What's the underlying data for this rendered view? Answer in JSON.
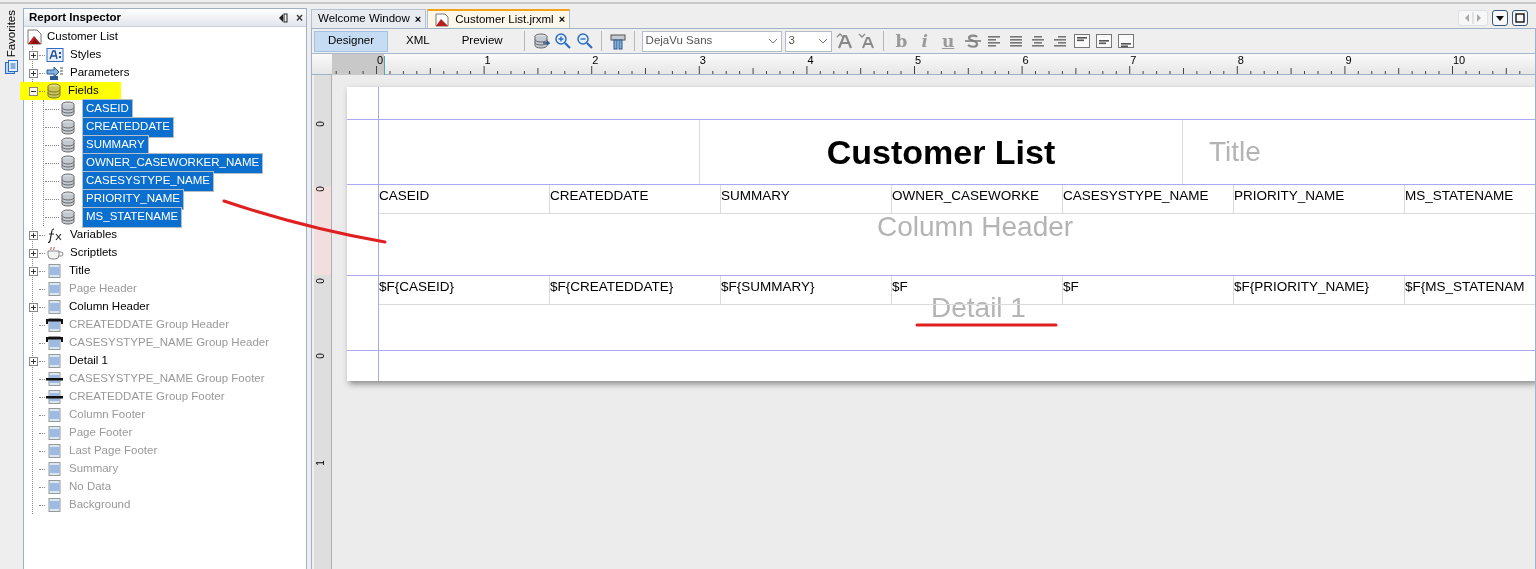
{
  "favorites_strip": {
    "label": "Favorites"
  },
  "inspector": {
    "title": "Report Inspector",
    "close": "×",
    "root": {
      "label": "Customer List"
    },
    "items": [
      {
        "label": "Styles",
        "kind": "styles",
        "expanded": false,
        "disabled": false,
        "highlighted": false
      },
      {
        "label": "Parameters",
        "kind": "parameters",
        "expanded": false,
        "disabled": false,
        "highlighted": false
      },
      {
        "label": "Fields",
        "kind": "fields",
        "expanded": true,
        "disabled": false,
        "highlighted": true,
        "children": [
          {
            "label": "CASEID",
            "selected": true
          },
          {
            "label": "CREATEDDATE",
            "selected": true
          },
          {
            "label": "SUMMARY",
            "selected": true
          },
          {
            "label": "OWNER_CASEWORKER_NAME",
            "selected": true
          },
          {
            "label": "CASESYSTYPE_NAME",
            "selected": true
          },
          {
            "label": "PRIORITY_NAME",
            "selected": true
          },
          {
            "label": "MS_STATENAME",
            "selected": true
          }
        ]
      },
      {
        "label": "Variables",
        "kind": "variables",
        "expanded": false,
        "disabled": false,
        "highlighted": false
      },
      {
        "label": "Scriptlets",
        "kind": "scriptlets",
        "expanded": false,
        "disabled": false,
        "highlighted": false
      },
      {
        "label": "Title",
        "kind": "band",
        "expanded": false,
        "disabled": false,
        "highlighted": false
      },
      {
        "label": "Page Header",
        "kind": "band",
        "disabled": true,
        "highlighted": false
      },
      {
        "label": "Column Header",
        "kind": "band",
        "expanded": false,
        "disabled": false,
        "highlighted": false
      },
      {
        "label": "CREATEDDATE Group Header",
        "kind": "group-header",
        "disabled": true,
        "highlighted": false
      },
      {
        "label": "CASESYSTYPE_NAME Group Header",
        "kind": "group-header",
        "disabled": true,
        "highlighted": false
      },
      {
        "label": "Detail 1",
        "kind": "band",
        "expanded": false,
        "disabled": false,
        "highlighted": false
      },
      {
        "label": "CASESYSTYPE_NAME Group Footer",
        "kind": "group-footer",
        "disabled": true,
        "highlighted": false
      },
      {
        "label": "CREATEDDATE Group Footer",
        "kind": "group-footer",
        "disabled": true,
        "highlighted": false
      },
      {
        "label": "Column Footer",
        "kind": "band",
        "disabled": true,
        "highlighted": false
      },
      {
        "label": "Page Footer",
        "kind": "band",
        "disabled": true,
        "highlighted": false
      },
      {
        "label": "Last Page Footer",
        "kind": "band",
        "disabled": true,
        "highlighted": false
      },
      {
        "label": "Summary",
        "kind": "band",
        "disabled": true,
        "highlighted": false
      },
      {
        "label": "No Data",
        "kind": "band",
        "disabled": true,
        "highlighted": false
      },
      {
        "label": "Background",
        "kind": "band",
        "disabled": true,
        "highlighted": false
      }
    ]
  },
  "editor_tabs": [
    {
      "label": "Welcome Window",
      "close": "×",
      "selected": false
    },
    {
      "label": "Customer List.jrxml",
      "close": "×",
      "selected": true
    }
  ],
  "toolbar": {
    "views": [
      {
        "label": "Designer",
        "selected": true
      },
      {
        "label": "XML",
        "selected": false
      },
      {
        "label": "Preview",
        "selected": false
      }
    ],
    "font": "DejaVu Sans",
    "size": "3",
    "format_buttons": [
      "b",
      "i",
      "u"
    ]
  },
  "ruler": {
    "labels": [
      "0",
      "1",
      "2",
      "3",
      "4",
      "5",
      "6",
      "7",
      "8",
      "9",
      "10"
    ]
  },
  "vertical_ruler": {
    "labels": [
      "0",
      "0",
      "0",
      "0",
      "1"
    ]
  },
  "report": {
    "title": "Customer List",
    "title_band_label": "Title",
    "column_header_label": "Column Header",
    "detail_label": "Detail 1",
    "column_headers": [
      "CASEID",
      "CREATEDDATE",
      "SUMMARY",
      "OWNER_CASEWORKE",
      "CASESYSTYPE_NAME",
      "PRIORITY_NAME",
      "MS_STATENAME"
    ],
    "detail_fields": [
      "$F{CASEID}",
      "$F{CREATEDDATE}",
      "$F{SUMMARY}",
      "$F",
      "$F",
      "$F{PRIORITY_NAME}",
      "$F{MS_STATENAM"
    ]
  },
  "annotations": [
    {
      "kind": "curve"
    },
    {
      "kind": "underline"
    }
  ]
}
